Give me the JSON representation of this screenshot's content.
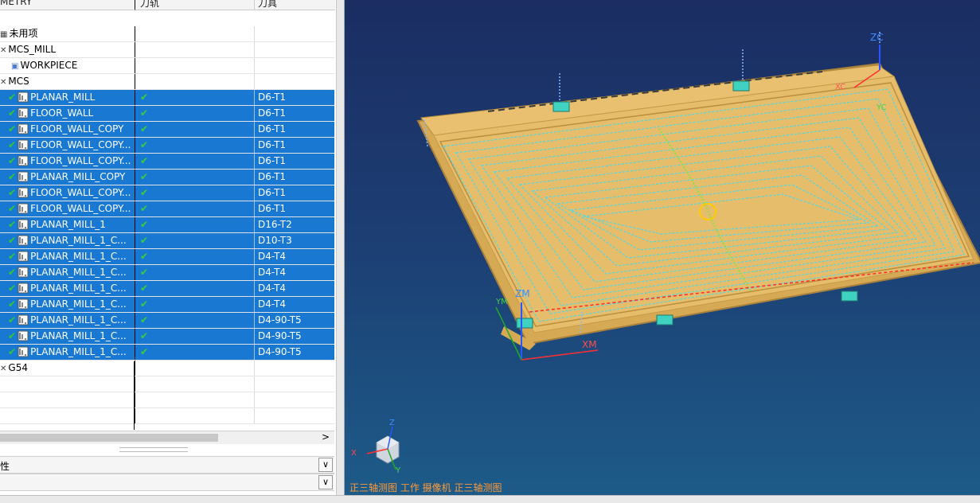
{
  "navigator": {
    "headers": {
      "name": "METRY",
      "toolpath": "刀轨",
      "tool": "刀具"
    },
    "rows": [
      {
        "name": "未用项",
        "toolpath": "",
        "tool": "",
        "selected": false,
        "indent": 1
      },
      {
        "name": "MCS_MILL",
        "toolpath": "",
        "tool": "",
        "selected": false,
        "indent": 1
      },
      {
        "name": "WORKPIECE",
        "toolpath": "",
        "tool": "",
        "selected": false,
        "indent": 2
      },
      {
        "name": "MCS",
        "toolpath": "",
        "tool": "",
        "selected": false,
        "indent": 1
      },
      {
        "name": "PLANAR_MILL",
        "toolpath": "✔",
        "tool": "D6-T1",
        "selected": true,
        "indent": 3
      },
      {
        "name": "FLOOR_WALL",
        "toolpath": "✔",
        "tool": "D6-T1",
        "selected": true,
        "indent": 3
      },
      {
        "name": "FLOOR_WALL_COPY",
        "toolpath": "✔",
        "tool": "D6-T1",
        "selected": true,
        "indent": 3
      },
      {
        "name": "FLOOR_WALL_COPY...",
        "toolpath": "✔",
        "tool": "D6-T1",
        "selected": true,
        "indent": 3
      },
      {
        "name": "FLOOR_WALL_COPY...",
        "toolpath": "✔",
        "tool": "D6-T1",
        "selected": true,
        "indent": 3
      },
      {
        "name": "PLANAR_MILL_COPY",
        "toolpath": "✔",
        "tool": "D6-T1",
        "selected": true,
        "indent": 3
      },
      {
        "name": "FLOOR_WALL_COPY...",
        "toolpath": "✔",
        "tool": "D6-T1",
        "selected": true,
        "indent": 3
      },
      {
        "name": "FLOOR_WALL_COPY...",
        "toolpath": "✔",
        "tool": "D6-T1",
        "selected": true,
        "indent": 3
      },
      {
        "name": "PLANAR_MILL_1",
        "toolpath": "✔",
        "tool": "D16-T2",
        "selected": true,
        "indent": 3
      },
      {
        "name": "PLANAR_MILL_1_C...",
        "toolpath": "✔",
        "tool": "D10-T3",
        "selected": true,
        "indent": 3
      },
      {
        "name": "PLANAR_MILL_1_C...",
        "toolpath": "✔",
        "tool": "D4-T4",
        "selected": true,
        "indent": 3
      },
      {
        "name": "PLANAR_MILL_1_C...",
        "toolpath": "✔",
        "tool": "D4-T4",
        "selected": true,
        "indent": 3
      },
      {
        "name": "PLANAR_MILL_1_C...",
        "toolpath": "✔",
        "tool": "D4-T4",
        "selected": true,
        "indent": 3
      },
      {
        "name": "PLANAR_MILL_1_C...",
        "toolpath": "✔",
        "tool": "D4-T4",
        "selected": true,
        "indent": 3
      },
      {
        "name": "PLANAR_MILL_1_C...",
        "toolpath": "✔",
        "tool": "D4-90-T5",
        "selected": true,
        "indent": 3
      },
      {
        "name": "PLANAR_MILL_1_C...",
        "toolpath": "✔",
        "tool": "D4-90-T5",
        "selected": true,
        "indent": 3
      },
      {
        "name": "PLANAR_MILL_1_C...",
        "toolpath": "✔",
        "tool": "D4-90-T5",
        "selected": true,
        "indent": 3
      },
      {
        "name": "G54",
        "toolpath": "",
        "tool": "",
        "selected": false,
        "indent": 1
      }
    ],
    "scroll_right": ">",
    "panel1_label": "性",
    "panel_chevron": "∨"
  },
  "viewport": {
    "status": "正三轴测图 工作 摄像机 正三轴测图",
    "axis_labels": {
      "zc": "ZC",
      "zm": "ZM",
      "xm": "XM",
      "xc": "XC",
      "yc": "YC",
      "ym": "YM"
    },
    "triad": {
      "x": "X",
      "y": "Y",
      "z": "Z"
    }
  },
  "colors": {
    "selection": "#1979d2",
    "part": "#e5bd6b",
    "toolpath": "#4fd8e8",
    "viewport_top": "#1b2d62"
  }
}
